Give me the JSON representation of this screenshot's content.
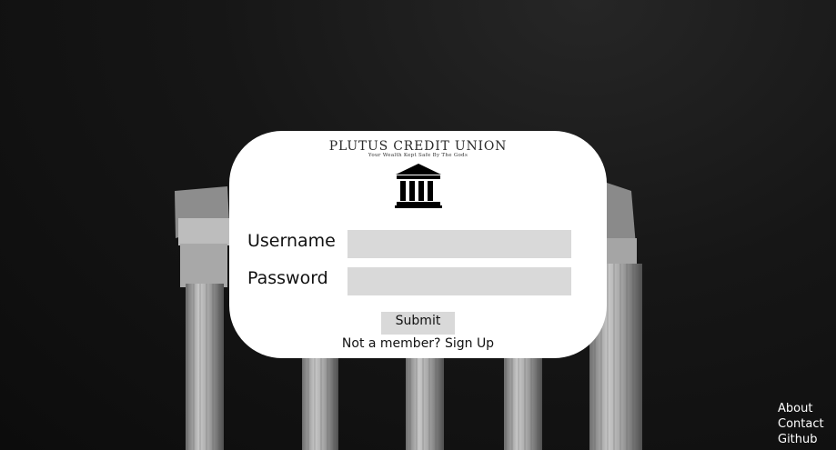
{
  "brand": {
    "name": "PLUTUS CREDIT UNION",
    "tagline": "Your Wealth Kept Safe By The Gods",
    "logo_icon": "bank-building-icon"
  },
  "form": {
    "username_label": "Username",
    "username_value": "",
    "password_label": "Password",
    "password_value": "",
    "submit_label": "Submit",
    "signup_prompt": "Not a member?",
    "signup_link": "Sign Up"
  },
  "footer": {
    "links": [
      "About",
      "Contact",
      "Github"
    ]
  },
  "colors": {
    "background": "#141414",
    "card": "#ffffff",
    "field": "#d9d9d9",
    "text": "#111111",
    "footer_text": "#ffffff"
  }
}
